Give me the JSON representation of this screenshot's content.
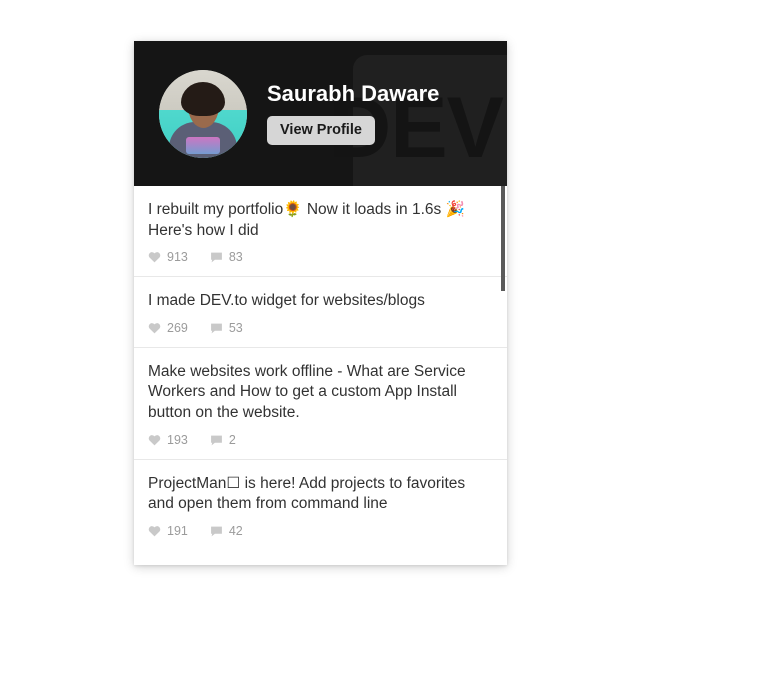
{
  "profile": {
    "name": "Saurabh Daware",
    "view_profile_label": "View Profile",
    "watermark_text": "DEV",
    "avatar_alt": "avatar"
  },
  "posts": [
    {
      "title": "I rebuilt my portfolio🌻 Now it loads in 1.6s 🎉 Here's how I did",
      "reactions": "913",
      "comments": "83"
    },
    {
      "title": "I made DEV.to widget for websites/blogs",
      "reactions": "269",
      "comments": "53"
    },
    {
      "title": "Make websites work offline - What are Service Workers and How to get a custom App Install button on the website.",
      "reactions": "193",
      "comments": "2"
    },
    {
      "title": "ProjectMan☐ is here! Add projects to favorites and open them from command line",
      "reactions": "191",
      "comments": "42"
    }
  ],
  "colors": {
    "header_background": "#151515",
    "watermark_panel": "#202020",
    "watermark_text": "#141414",
    "button_background": "#d6d6d6",
    "card_background": "#ffffff",
    "divider": "#e8e8e8",
    "title_text": "#323232",
    "stat_text": "#9b9b9b",
    "icon": "#c9c9c9",
    "scrollbar_thumb": "#5a5a5a",
    "page_background": "#ffffff"
  },
  "icons": {
    "heart": "heart-icon",
    "comment": "comment-icon"
  }
}
